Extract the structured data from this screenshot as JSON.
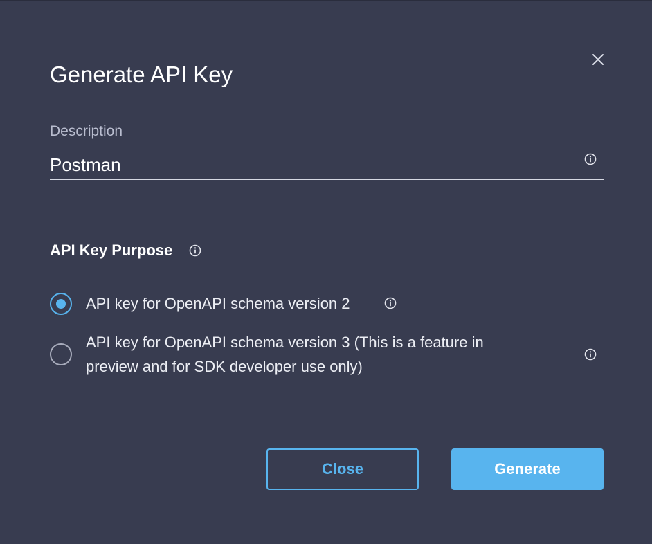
{
  "dialog": {
    "title": "Generate API Key",
    "close_icon": "close-icon"
  },
  "description": {
    "label": "Description",
    "value": "Postman",
    "info_icon": "info-icon"
  },
  "purpose": {
    "label": "API Key Purpose",
    "info_icon": "info-icon",
    "options": [
      {
        "label": "API key for OpenAPI schema version 2",
        "selected": true
      },
      {
        "label_line1": "API key for OpenAPI schema version 3 (This is a feature in",
        "label_line2": "preview and for SDK developer use only)",
        "selected": false
      }
    ]
  },
  "buttons": {
    "close_label": "Close",
    "generate_label": "Generate"
  },
  "colors": {
    "background": "#383c50",
    "accent": "#58b4ee"
  }
}
